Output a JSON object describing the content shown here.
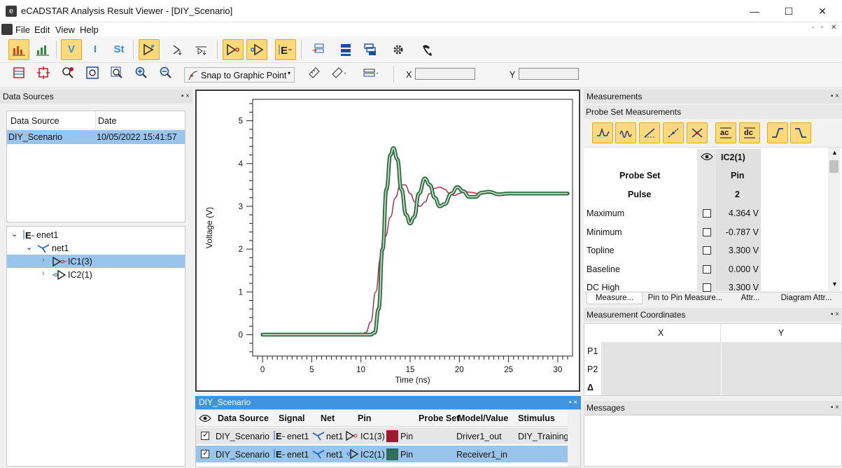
{
  "window": {
    "title": "eCADSTAR Analysis Result Viewer - [DIY_Scenario]",
    "controls": {
      "minimize": "—",
      "maximize": "☐",
      "close": "✕"
    }
  },
  "menu": {
    "items": [
      "File",
      "Edit",
      "View",
      "Help"
    ],
    "mdi_controls": [
      "-",
      "▫",
      "✕"
    ]
  },
  "toolbar1": {
    "letters": {
      "voltage": "V",
      "current": "I",
      "state": "St"
    }
  },
  "toolbar2": {
    "snap_label": "Snap to Graphic Point",
    "x_label": "X",
    "y_label": "Y",
    "x_value": "",
    "y_value": ""
  },
  "data_sources_panel": {
    "title": "Data Sources",
    "pin_close": "▪ ×",
    "columns": [
      "Data Source",
      "Date"
    ],
    "rows": [
      {
        "source": "DIY_Scenario",
        "date": "10/05/2022 15:41:57"
      }
    ],
    "tree": {
      "root": "enet1",
      "net": "net1",
      "children": [
        "IC1(3)",
        "IC2(1)"
      ]
    }
  },
  "chart_data": {
    "type": "line",
    "title": "",
    "xlabel": "Time (ns)",
    "ylabel": "Voltage (V)",
    "xlim": [
      -1,
      31.5
    ],
    "ylim": [
      -0.5,
      5.5
    ],
    "x_ticks": [
      0,
      5,
      10,
      15,
      20,
      25,
      30
    ],
    "y_ticks": [
      0,
      1,
      2,
      3,
      4,
      5
    ],
    "grid": false,
    "series": [
      {
        "name": "IC1(3)",
        "color": "#b0223a",
        "points": [
          [
            0,
            0
          ],
          [
            10,
            0
          ],
          [
            10.5,
            0.05
          ],
          [
            11,
            0.3
          ],
          [
            11.5,
            1.0
          ],
          [
            12,
            1.8
          ],
          [
            12.5,
            2.3
          ],
          [
            13,
            2.75
          ],
          [
            13.5,
            3.2
          ],
          [
            14,
            3.5
          ],
          [
            14.5,
            3.5
          ],
          [
            15,
            3.3
          ],
          [
            15.5,
            3.1
          ],
          [
            16,
            3.0
          ],
          [
            16.5,
            3.1
          ],
          [
            17,
            3.3
          ],
          [
            17.5,
            3.42
          ],
          [
            18,
            3.45
          ],
          [
            18.5,
            3.4
          ],
          [
            19,
            3.3
          ],
          [
            19.5,
            3.25
          ],
          [
            20,
            3.3
          ],
          [
            20.5,
            3.35
          ],
          [
            21,
            3.33
          ],
          [
            22,
            3.3
          ],
          [
            31,
            3.3
          ]
        ]
      },
      {
        "name": "IC2(1)",
        "color": "#2e6f44",
        "points": [
          [
            0,
            0
          ],
          [
            11,
            0
          ],
          [
            11.4,
            0.05
          ],
          [
            11.8,
            0.6
          ],
          [
            12.2,
            2.0
          ],
          [
            12.6,
            3.4
          ],
          [
            13,
            4.2
          ],
          [
            13.3,
            4.36
          ],
          [
            13.7,
            4.1
          ],
          [
            14.1,
            3.4
          ],
          [
            14.6,
            2.8
          ],
          [
            15,
            2.6
          ],
          [
            15.4,
            2.75
          ],
          [
            15.9,
            3.3
          ],
          [
            16.5,
            3.65
          ],
          [
            17,
            3.5
          ],
          [
            17.5,
            3.2
          ],
          [
            18,
            3.0
          ],
          [
            18.5,
            3.05
          ],
          [
            19.2,
            3.3
          ],
          [
            19.8,
            3.45
          ],
          [
            20.4,
            3.35
          ],
          [
            21,
            3.22
          ],
          [
            21.6,
            3.22
          ],
          [
            22.3,
            3.32
          ],
          [
            23,
            3.34
          ],
          [
            24,
            3.28
          ],
          [
            25,
            3.3
          ],
          [
            31,
            3.3
          ]
        ]
      }
    ]
  },
  "signals_panel": {
    "title": "DIY_Scenario",
    "columns": [
      "Data Source",
      "Signal",
      "Net",
      "Pin",
      "Probe Set",
      "Model/Value",
      "Stimulus"
    ],
    "rows": [
      {
        "source": "DIY_Scenario",
        "signal": "enet1",
        "net": "net1",
        "pin": "IC1(3)",
        "probe_set": "Pin",
        "probe_color": "#9e1a30",
        "model": "Driver1_out",
        "stimulus": "DIY_Training"
      },
      {
        "source": "DIY_Scenario",
        "signal": "enet1",
        "net": "net1",
        "pin": "IC2(1)",
        "probe_set": "Pin",
        "probe_color": "#2f6d5f",
        "model": "Receiver1_in",
        "stimulus": ""
      }
    ]
  },
  "measurements_panel": {
    "title": "Measurements",
    "subtitle": "Probe Set Measurements",
    "column_header": "IC2(1)",
    "probe_set_label": "Probe Set",
    "probe_set_value": "Pin",
    "pulse_label": "Pulse",
    "pulse_value": "2",
    "rows": [
      {
        "name": "Maximum",
        "value": "4.364 V"
      },
      {
        "name": "Minimum",
        "value": "-0.787 V"
      },
      {
        "name": "Topline",
        "value": "3.300 V"
      },
      {
        "name": "Baseline",
        "value": "0.000 V"
      },
      {
        "name": "DC High",
        "value": "3.300 V"
      }
    ],
    "tabs": [
      "Measure...",
      "Pin to Pin Measure...",
      "Attr...",
      "Diagram Attr..."
    ]
  },
  "coords_panel": {
    "title": "Measurement Coordinates",
    "columns": [
      "X",
      "Y"
    ],
    "rows": [
      "P1",
      "P2",
      "Δ"
    ]
  },
  "messages_panel": {
    "title": "Messages"
  }
}
